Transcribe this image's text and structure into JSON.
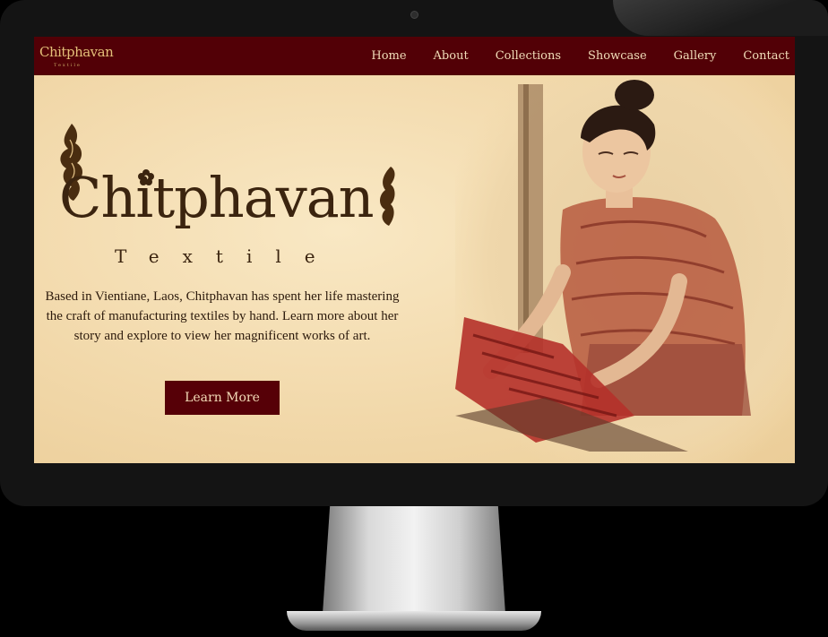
{
  "brand": {
    "logo_text": "Chitphavan",
    "logo_sub": "Textile",
    "title": "Chitphavan",
    "subtitle": "Textile"
  },
  "nav": {
    "items": [
      {
        "label": "Home"
      },
      {
        "label": "About"
      },
      {
        "label": "Collections"
      },
      {
        "label": "Showcase"
      },
      {
        "label": "Gallery"
      },
      {
        "label": "Contact"
      }
    ]
  },
  "hero": {
    "description": "Based in Vientiane, Laos, Chitphavan has spent her life mastering the craft of manufacturing textiles by hand. Learn more about her story and explore to view her magnificent works of art.",
    "button_label": "Learn More"
  },
  "colors": {
    "nav_bg": "#520006",
    "accent": "#560007",
    "background": "#f3ddb1",
    "text_dark": "#3b240f",
    "logo_gold": "#e3bf79"
  }
}
